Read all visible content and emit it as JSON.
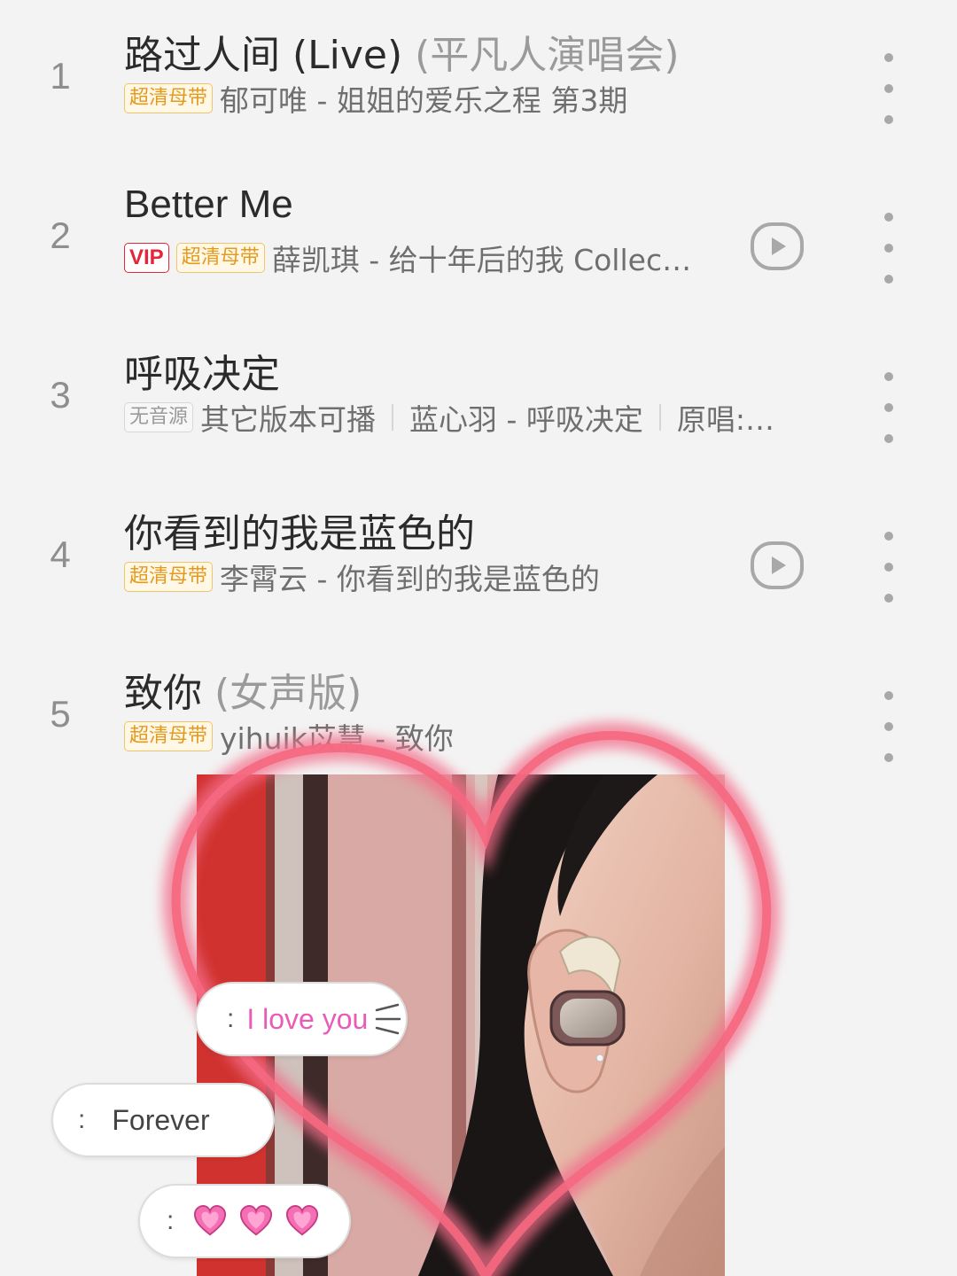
{
  "songs": [
    {
      "index": "1",
      "title": "路过人间 (Live)",
      "title_suffix": "(平凡人演唱会)",
      "badges": [
        "超清母带"
      ],
      "subtitle": "郁可唯 - 姐姐的爱乐之程 第3期",
      "has_mv": false
    },
    {
      "index": "2",
      "title": "Better Me",
      "title_suffix": "",
      "badges": [
        "VIP",
        "超清母带"
      ],
      "subtitle": "薛凯琪 - 给十年后的我 Collec…",
      "has_mv": true
    },
    {
      "index": "3",
      "title": "呼吸决定",
      "title_suffix": "",
      "badges": [
        "无音源"
      ],
      "subtitle_parts": [
        "其它版本可播",
        "蓝心羽 - 呼吸决定",
        "原唱:…"
      ],
      "has_mv": false
    },
    {
      "index": "4",
      "title": "你看到的我是蓝色的",
      "title_suffix": "",
      "badges": [
        "超清母带"
      ],
      "subtitle": "李霄云 - 你看到的我是蓝色的",
      "has_mv": true
    },
    {
      "index": "5",
      "title": "致你",
      "title_suffix": "(女声版)",
      "badges": [
        "超清母带"
      ],
      "subtitle": "yihuik苡慧 - 致你",
      "has_mv": false
    }
  ],
  "bubbles": {
    "first": {
      "prefix": ":",
      "text": "I love you"
    },
    "second": {
      "prefix": ":",
      "text": "Forever"
    },
    "third": {
      "prefix": ":",
      "emojis": [
        "pink-heart",
        "pink-heart",
        "pink-heart"
      ]
    }
  },
  "colors": {
    "master_badge": "#e49a1e",
    "vip_badge": "#e3263a",
    "heart_outline": "#f0506e",
    "love_text": "#e85cb8"
  },
  "icons": {
    "more": "vertical-ellipsis-icon",
    "mv": "play-circle-icon"
  }
}
